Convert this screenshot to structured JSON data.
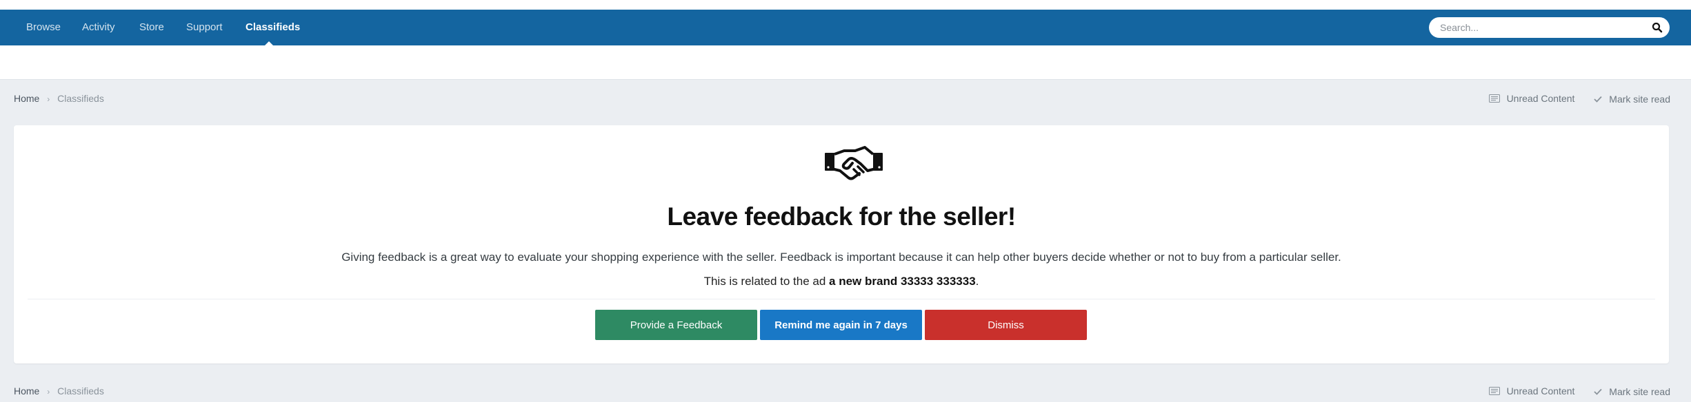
{
  "nav": {
    "items": [
      {
        "label": "Browse"
      },
      {
        "label": "Activity"
      },
      {
        "label": "Store"
      },
      {
        "label": "Support"
      },
      {
        "label": "Classifieds",
        "active": true
      }
    ],
    "search_placeholder": "Search..."
  },
  "breadcrumb": {
    "home": "Home",
    "current": "Classifieds"
  },
  "actions": {
    "unread": "Unread Content",
    "mark_read": "Mark site read"
  },
  "feedback": {
    "icon": "handshake-icon",
    "title": "Leave feedback for the seller!",
    "description": "Giving feedback is a great way to evaluate your shopping experience with the seller. Feedback is important because it can help other buyers decide whether or not to buy from a particular seller.",
    "related_prefix": "This is related to the ad ",
    "ad_name": "a new brand 33333 333333",
    "related_suffix": ".",
    "buttons": {
      "provide": "Provide a Feedback",
      "remind": "Remind me again in 7 days",
      "dismiss": "Dismiss"
    }
  },
  "colors": {
    "nav_bg": "#1465a0",
    "page_bg": "#ebeef2",
    "green": "#2e8a63",
    "blue": "#1978c6",
    "red": "#c9302c"
  }
}
